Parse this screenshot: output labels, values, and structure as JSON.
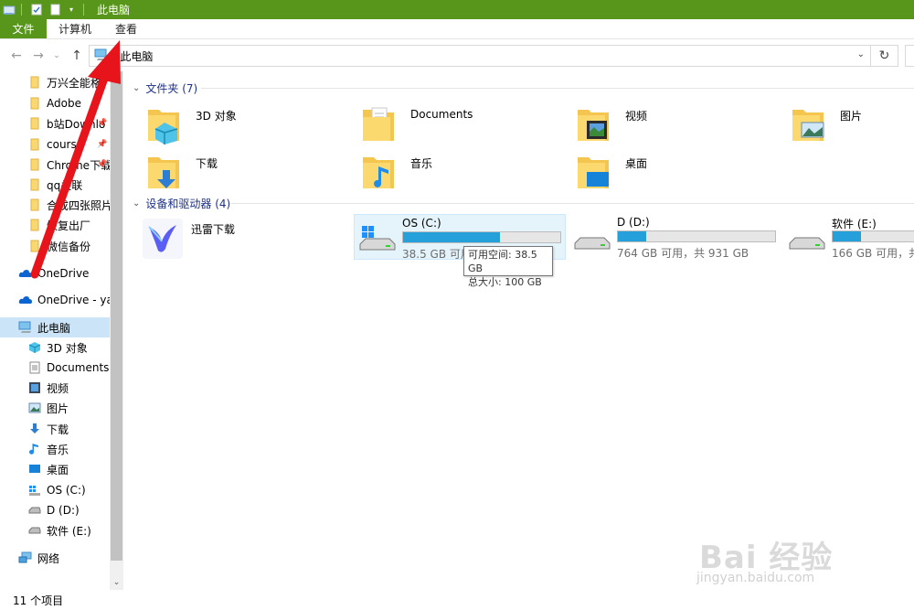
{
  "titlebar": {
    "title": "此电脑",
    "bg_color": "#58951b"
  },
  "ribbon": {
    "tabs": [
      {
        "label": "文件"
      },
      {
        "label": "计算机"
      },
      {
        "label": "查看"
      }
    ]
  },
  "address": {
    "path": "此电脑"
  },
  "sidebar": {
    "quick_access": [
      {
        "label": "万兴全能格",
        "icon": "folder-icon"
      },
      {
        "label": "Adobe",
        "icon": "folder-icon"
      },
      {
        "label": "b站Downlo",
        "icon": "folder-icon",
        "pinned": true
      },
      {
        "label": "course",
        "icon": "folder-icon",
        "pinned": true
      },
      {
        "label": "Chrome下载",
        "icon": "folder-icon",
        "pinned": true
      },
      {
        "label": "qq关联",
        "icon": "folder-icon"
      },
      {
        "label": "合成四张照片",
        "icon": "folder-icon"
      },
      {
        "label": "恢复出厂",
        "icon": "folder-icon"
      },
      {
        "label": "微信备份",
        "icon": "folder-icon"
      }
    ],
    "onedrive": {
      "label": "OneDrive"
    },
    "onedrive2": {
      "label": "OneDrive - yan"
    },
    "thispc": {
      "label": "此电脑"
    },
    "pc_items": [
      {
        "label": "3D 对象",
        "icon": "3d-objects-icon"
      },
      {
        "label": "Documents",
        "icon": "documents-icon"
      },
      {
        "label": "视频",
        "icon": "videos-icon"
      },
      {
        "label": "图片",
        "icon": "pictures-icon"
      },
      {
        "label": "下载",
        "icon": "downloads-icon"
      },
      {
        "label": "音乐",
        "icon": "music-icon"
      },
      {
        "label": "桌面",
        "icon": "desktop-icon"
      },
      {
        "label": "OS (C:)",
        "icon": "os-drive-icon"
      },
      {
        "label": "D (D:)",
        "icon": "drive-icon"
      },
      {
        "label": "软件 (E:)",
        "icon": "drive-icon"
      }
    ],
    "network": {
      "label": "网络"
    }
  },
  "content": {
    "folders_header": "文件夹 (7)",
    "folders": [
      {
        "label": "3D 对象",
        "icon": "3d-objects-icon"
      },
      {
        "label": "Documents",
        "icon": "documents-icon"
      },
      {
        "label": "视频",
        "icon": "videos-icon"
      },
      {
        "label": "图片",
        "icon": "pictures-icon"
      },
      {
        "label": "下载",
        "icon": "downloads-icon"
      },
      {
        "label": "音乐",
        "icon": "music-icon"
      },
      {
        "label": "桌面",
        "icon": "desktop-icon"
      }
    ],
    "devices_header": "设备和驱动器 (4)",
    "app_device": {
      "label": "迅雷下载",
      "icon": "xunlei-icon"
    },
    "drives": [
      {
        "name": "OS (C:)",
        "free_text": "38.5 GB 可用",
        "used_fraction": 0.615
      },
      {
        "name": "D (D:)",
        "free_text": "764 GB 可用，共 931 GB",
        "used_fraction": 0.18
      },
      {
        "name": "软件 (E:)",
        "free_text": "166 GB 可用，共",
        "used_fraction": 0.18
      }
    ],
    "tooltip": {
      "line1": "可用空间: 38.5 GB",
      "line2": "总大小: 100 GB"
    }
  },
  "statusbar": {
    "count": "11 个项目"
  },
  "watermark": {
    "line1": "Bai 经验",
    "line2": "jingyan.baidu.com"
  },
  "colors": {
    "accent_green": "#58951b",
    "drive_bar": "#26a0da",
    "selection": "#cce4f7",
    "header_blue": "#1e3287",
    "annotation_red": "#e8141b"
  }
}
